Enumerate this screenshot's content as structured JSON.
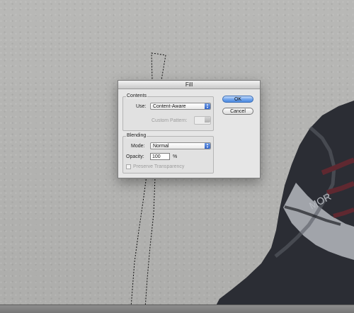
{
  "dialog": {
    "title": "Fill",
    "contents_label": "Contents",
    "use_label": "Use:",
    "use_value": "Content-Aware",
    "custom_pattern_label": "Custom Pattern:",
    "blending_label": "Blending",
    "mode_label": "Mode:",
    "mode_value": "Normal",
    "opacity_label": "Opacity:",
    "opacity_value": "100",
    "opacity_unit": "%",
    "preserve_label": "Preserve Transparency",
    "ok_label": "OK",
    "cancel_label": "Cancel"
  },
  "artwork": {
    "jacket_text": "MOR"
  },
  "colors": {
    "accent": "#4d8ae0",
    "dialog_bg": "#e6e6e6",
    "canvas": "#b6b6b4"
  }
}
